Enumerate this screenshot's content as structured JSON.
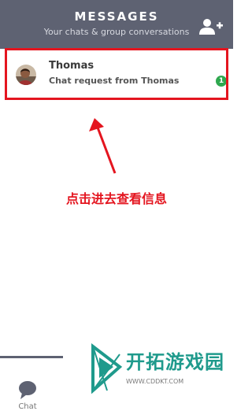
{
  "header": {
    "title": "MESSAGES",
    "subtitle": "Your chats & group conversations",
    "add_user_icon": "add-user-icon"
  },
  "conversations": [
    {
      "name": "Thomas",
      "message": "Chat request from Thomas",
      "unread_count": "1",
      "avatar_icon": "avatar"
    }
  ],
  "annotation": {
    "text": "点击进去查看信息",
    "color": "#e4151f"
  },
  "bottom_nav": {
    "chat_label": "Chat",
    "chat_icon": "chat-bubble-icon"
  },
  "watermark": {
    "title": "开拓游戏园",
    "url": "WWW.CDDKT.COM"
  },
  "colors": {
    "header_bg": "#5e6272",
    "highlight": "#e4151f",
    "unread_badge": "#2fa84f",
    "watermark": "#1f9a8c"
  }
}
